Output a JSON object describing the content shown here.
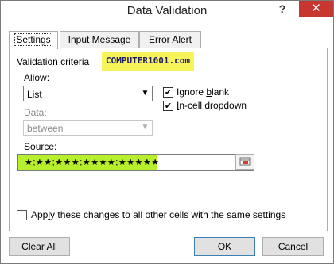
{
  "window": {
    "title": "Data Validation",
    "help_glyph": "?",
    "close_glyph": "✕"
  },
  "tabs": [
    {
      "label": "Settings",
      "active": true
    },
    {
      "label": "Input Message",
      "active": false
    },
    {
      "label": "Error Alert",
      "active": false
    }
  ],
  "criteria": {
    "heading": "Validation criteria",
    "allow_label_u": "A",
    "allow_label_rest": "llow:",
    "allow_value": "List",
    "data_label": "Data:",
    "data_value": "between",
    "ignore_blank_pre": "Ignore ",
    "ignore_blank_u": "b",
    "ignore_blank_post": "lank",
    "ignore_blank_checked": true,
    "dropdown_u": "I",
    "dropdown_post": "n-cell dropdown",
    "dropdown_checked": true,
    "source_label_u": "S",
    "source_label_rest": "ource:",
    "source_value": "★;★★;★★★;★★★★;★★★★★"
  },
  "watermark": "COMPUTER1001.com",
  "apply_all": {
    "pre": "App",
    "u": "l",
    "post": "y these changes to all other cells with the same settings",
    "checked": false
  },
  "buttons": {
    "clear_u": "C",
    "clear_rest": "lear All",
    "ok": "OK",
    "cancel": "Cancel"
  },
  "icons": {
    "check": "✔",
    "dropdown_arrow": "▼"
  }
}
